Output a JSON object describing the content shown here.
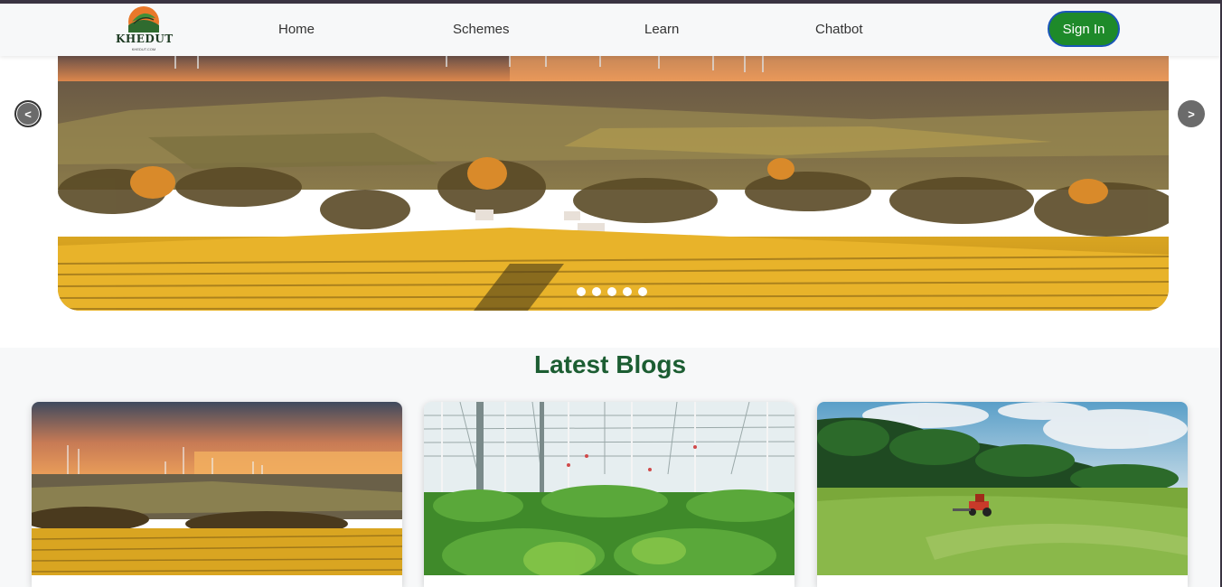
{
  "navbar": {
    "logo_text": "KHEDUT",
    "logo_subtext": "KHEDUT.COM",
    "links": [
      {
        "label": "Home"
      },
      {
        "label": "Schemes"
      },
      {
        "label": "Learn"
      },
      {
        "label": "Chatbot"
      }
    ],
    "signin_label": "Sign In"
  },
  "carousel": {
    "prev_label": "<",
    "next_label": ">",
    "slide_count": 5,
    "active_slide": 1
  },
  "blogs": {
    "title": "Latest Blogs"
  },
  "colors": {
    "brand_green": "#1e8a2a",
    "title_green": "#1c5d32",
    "signin_border": "#1a56b8"
  }
}
